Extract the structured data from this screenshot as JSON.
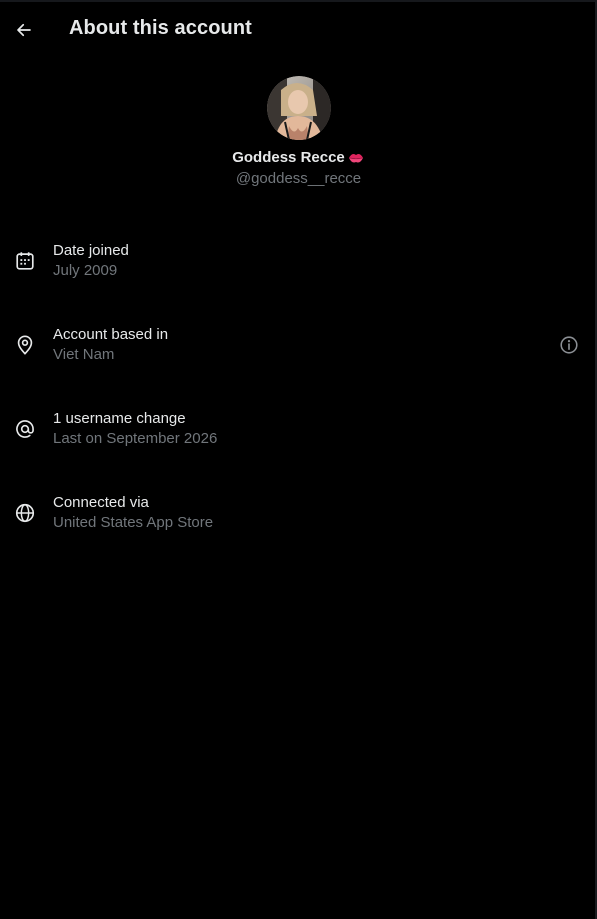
{
  "header": {
    "title": "About this account",
    "back_icon": "arrow-left-icon"
  },
  "profile": {
    "display_name": "Goddess Recce",
    "name_emoji": "kiss-mark-icon",
    "handle": "@goddess__recce",
    "avatar": "profile-photo"
  },
  "rows": [
    {
      "icon": "calendar-icon",
      "label": "Date joined",
      "value": "July 2009"
    },
    {
      "icon": "location-pin-icon",
      "label": "Account based in",
      "value": "Viet Nam",
      "action_icon": "info-icon"
    },
    {
      "icon": "at-sign-icon",
      "label": "1 username change",
      "value": "Last on September 2026"
    },
    {
      "icon": "globe-icon",
      "label": "Connected via",
      "value": "United States App Store"
    }
  ],
  "colors": {
    "background": "#000000",
    "primary_text": "#e7e9ea",
    "secondary_text": "#71767b",
    "emoji_pink": "#e0245e"
  }
}
